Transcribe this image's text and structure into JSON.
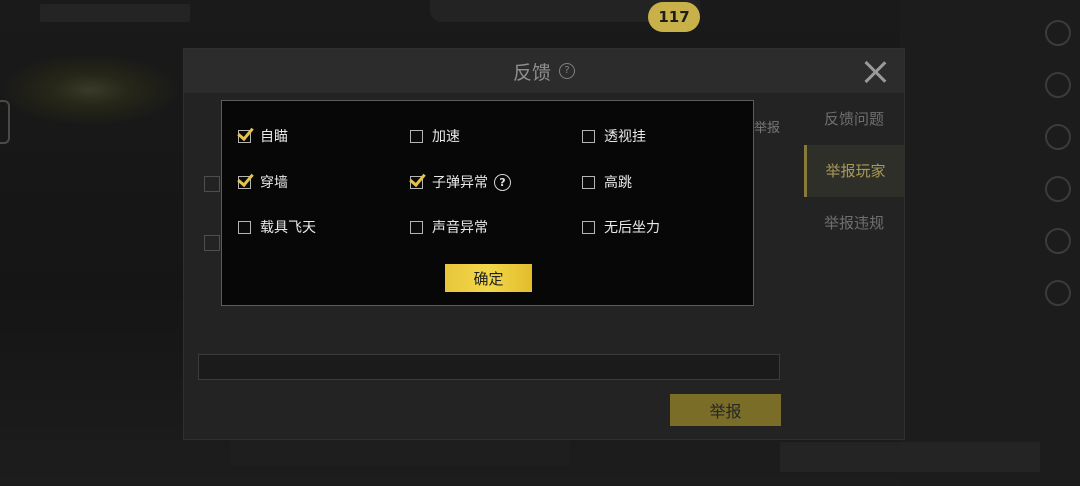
{
  "hud": {
    "timer": "117"
  },
  "feedback_dialog": {
    "title": "反馈",
    "tabs": [
      {
        "label": "反馈问题",
        "active": false
      },
      {
        "label": "举报玩家",
        "active": true
      },
      {
        "label": "举报违规",
        "active": false
      }
    ],
    "report_link": "举报",
    "report_button": "举报"
  },
  "popup": {
    "options": [
      {
        "label": "自瞄",
        "checked": true,
        "help": false
      },
      {
        "label": "加速",
        "checked": false,
        "help": false
      },
      {
        "label": "透视挂",
        "checked": false,
        "help": false
      },
      {
        "label": "穿墙",
        "checked": true,
        "help": false
      },
      {
        "label": "子弹异常",
        "checked": true,
        "help": true
      },
      {
        "label": "高跳",
        "checked": false,
        "help": false
      },
      {
        "label": "载具飞天",
        "checked": false,
        "help": false
      },
      {
        "label": "声音异常",
        "checked": false,
        "help": false
      },
      {
        "label": "无后坐力",
        "checked": false,
        "help": false
      }
    ],
    "help_glyph": "?",
    "confirm_label": "确定"
  },
  "colors": {
    "accent": "#e8c63a",
    "check": "#e3c34a",
    "popup_bg": "#070707"
  }
}
